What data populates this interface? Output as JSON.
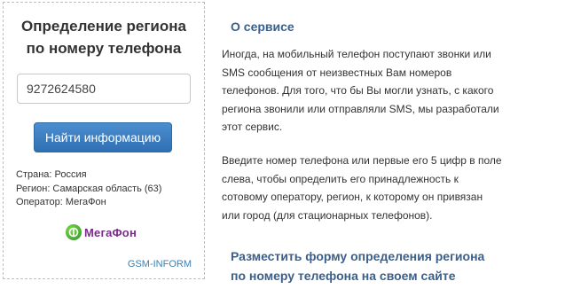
{
  "widget": {
    "title_line1": "Определение региона",
    "title_line2": "по номеру телефона",
    "phone_value": "9272624580",
    "find_button_label": "Найти информацию",
    "result": {
      "country": "Страна: Россия",
      "region": "Регион: Самарская область (63)",
      "operator": "Оператор: МегаФон"
    },
    "logo_text": "МегаФон",
    "link_label": "GSM-INFORM"
  },
  "about": {
    "title": "О сервисе",
    "paragraph1": [
      "Иногда, на мобильный телефон поступают звонки или",
      "SMS сообщения от неизвестных Вам номеров",
      "телефонов. Для того, что бы Вы могли узнать, с какого",
      "региона звонили или отправляли SMS, мы разработали",
      "этот сервис."
    ],
    "paragraph2": [
      "Введите номер телефона или первые его 5 цифр в поле",
      "слева, чтобы определить его принадлежность к",
      "сотовому оператору, регион, к которому он привязан",
      "или город (для стационарных телефонов)."
    ]
  },
  "place_form": {
    "title_line1": "Разместить форму определения региона",
    "title_line2": "по номеру телефона на своем сайте"
  },
  "colors": {
    "section_title": "#3a5f8a",
    "button": "#2f6fb3",
    "link": "#3c7fb1",
    "logo_text": "#7a2a8c"
  }
}
